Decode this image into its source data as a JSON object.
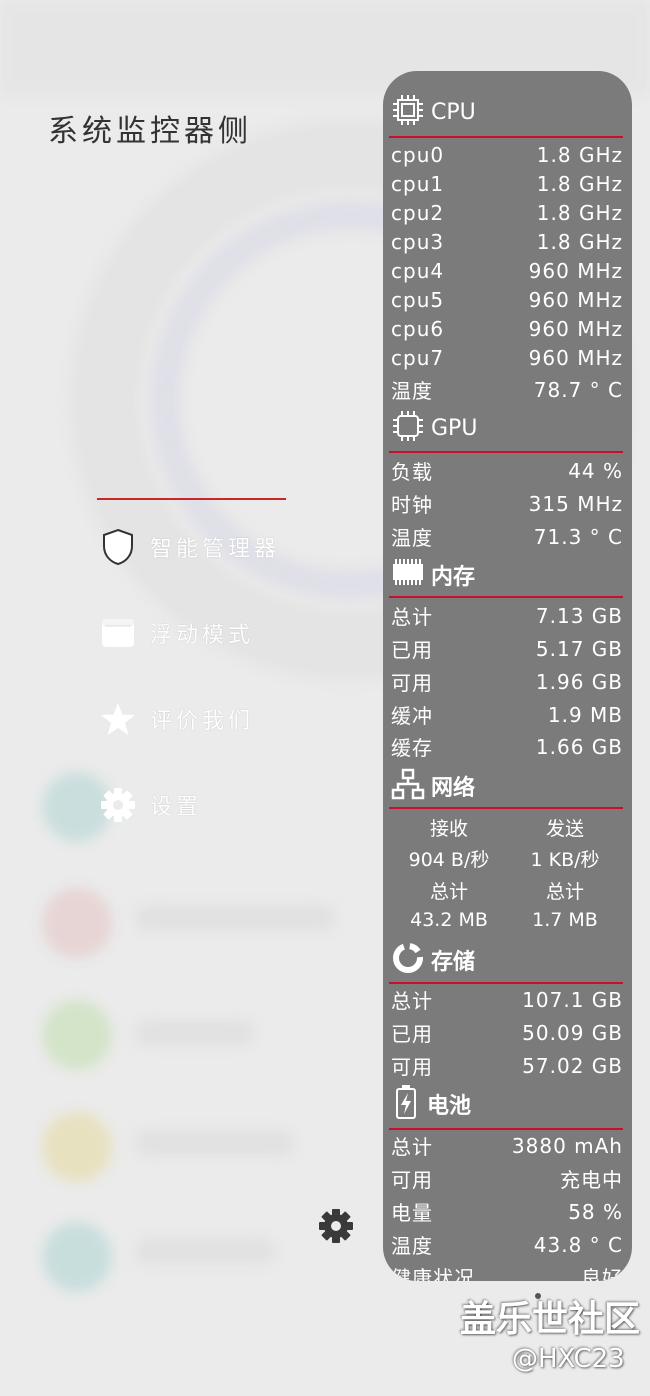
{
  "drawer": {
    "title": "系统监控器侧",
    "menu": [
      {
        "label": "智能管理器",
        "icon": "shield-icon"
      },
      {
        "label": "浮动模式",
        "icon": "window-icon"
      },
      {
        "label": "评价我们",
        "icon": "star-icon"
      },
      {
        "label": "设置",
        "icon": "gear-icon"
      }
    ]
  },
  "panel": {
    "cpu": {
      "title": "CPU",
      "cores": [
        {
          "name": "cpu0",
          "value": "1.8 GHz"
        },
        {
          "name": "cpu1",
          "value": "1.8 GHz"
        },
        {
          "name": "cpu2",
          "value": "1.8 GHz"
        },
        {
          "name": "cpu3",
          "value": "1.8 GHz"
        },
        {
          "name": "cpu4",
          "value": "960 MHz"
        },
        {
          "name": "cpu5",
          "value": "960 MHz"
        },
        {
          "name": "cpu6",
          "value": "960 MHz"
        },
        {
          "name": "cpu7",
          "value": "960 MHz"
        }
      ],
      "temp_label": "温度",
      "temp_value": "78.7 ° C"
    },
    "gpu": {
      "title": "GPU",
      "rows": [
        {
          "label": "负载",
          "value": "44 %"
        },
        {
          "label": "时钟",
          "value": "315 MHz"
        },
        {
          "label": "温度",
          "value": "71.3 ° C"
        }
      ]
    },
    "memory": {
      "title": "内存",
      "rows": [
        {
          "label": "总计",
          "value": "7.13 GB"
        },
        {
          "label": "已用",
          "value": "5.17 GB"
        },
        {
          "label": "可用",
          "value": "1.96 GB"
        },
        {
          "label": "缓冲",
          "value": "1.9 MB"
        },
        {
          "label": "缓存",
          "value": "1.66 GB"
        }
      ]
    },
    "network": {
      "title": "网络",
      "recv_label": "接收",
      "send_label": "发送",
      "recv_rate": "904 B/秒",
      "send_rate": "1 KB/秒",
      "recv_total_label": "总计",
      "send_total_label": "总计",
      "recv_total": "43.2 MB",
      "send_total": "1.7 MB"
    },
    "storage": {
      "title": "存储",
      "rows": [
        {
          "label": "总计",
          "value": "107.1 GB"
        },
        {
          "label": "已用",
          "value": "50.09 GB"
        },
        {
          "label": "可用",
          "value": "57.02 GB"
        }
      ]
    },
    "battery": {
      "title": "电池",
      "rows": [
        {
          "label": "总计",
          "value": "3880 mAh"
        },
        {
          "label": "可用",
          "value": "充电中"
        },
        {
          "label": "电量",
          "value": "58 %"
        },
        {
          "label": "温度",
          "value": "43.8 ° C"
        }
      ],
      "partial_label": "健康状况",
      "partial_value": "良好"
    }
  },
  "watermark": {
    "line1": "盖乐世社区",
    "line2": "@HXC23"
  },
  "colors": {
    "panel_bg": "#7b7b7b",
    "rule": "#c8102e",
    "drawer_line": "#c62828"
  }
}
